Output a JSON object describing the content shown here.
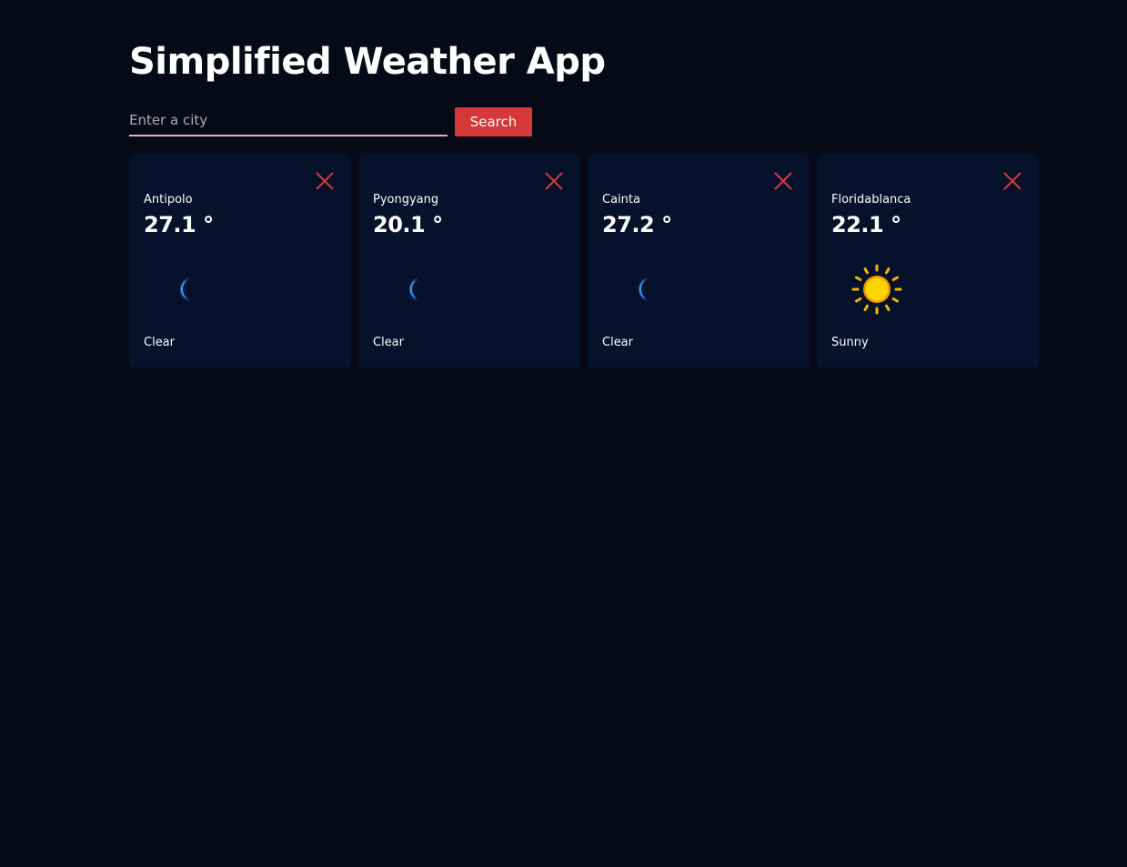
{
  "app": {
    "title": "Simplified Weather App"
  },
  "search": {
    "placeholder": "Enter a city",
    "value": "",
    "button_label": "Search"
  },
  "colors": {
    "background": "#050a16",
    "card": "#06112b",
    "accent": "#d6383a"
  },
  "cards": [
    {
      "city": "Antipolo",
      "temp": "27.1 °",
      "condition": "Clear",
      "icon": "moon-icon"
    },
    {
      "city": "Pyongyang",
      "temp": "20.1 °",
      "condition": "Clear",
      "icon": "moon-icon"
    },
    {
      "city": "Cainta",
      "temp": "27.2 °",
      "condition": "Clear",
      "icon": "moon-icon"
    },
    {
      "city": "Floridablanca",
      "temp": "22.1 °",
      "condition": "Sunny",
      "icon": "sun-icon"
    }
  ]
}
